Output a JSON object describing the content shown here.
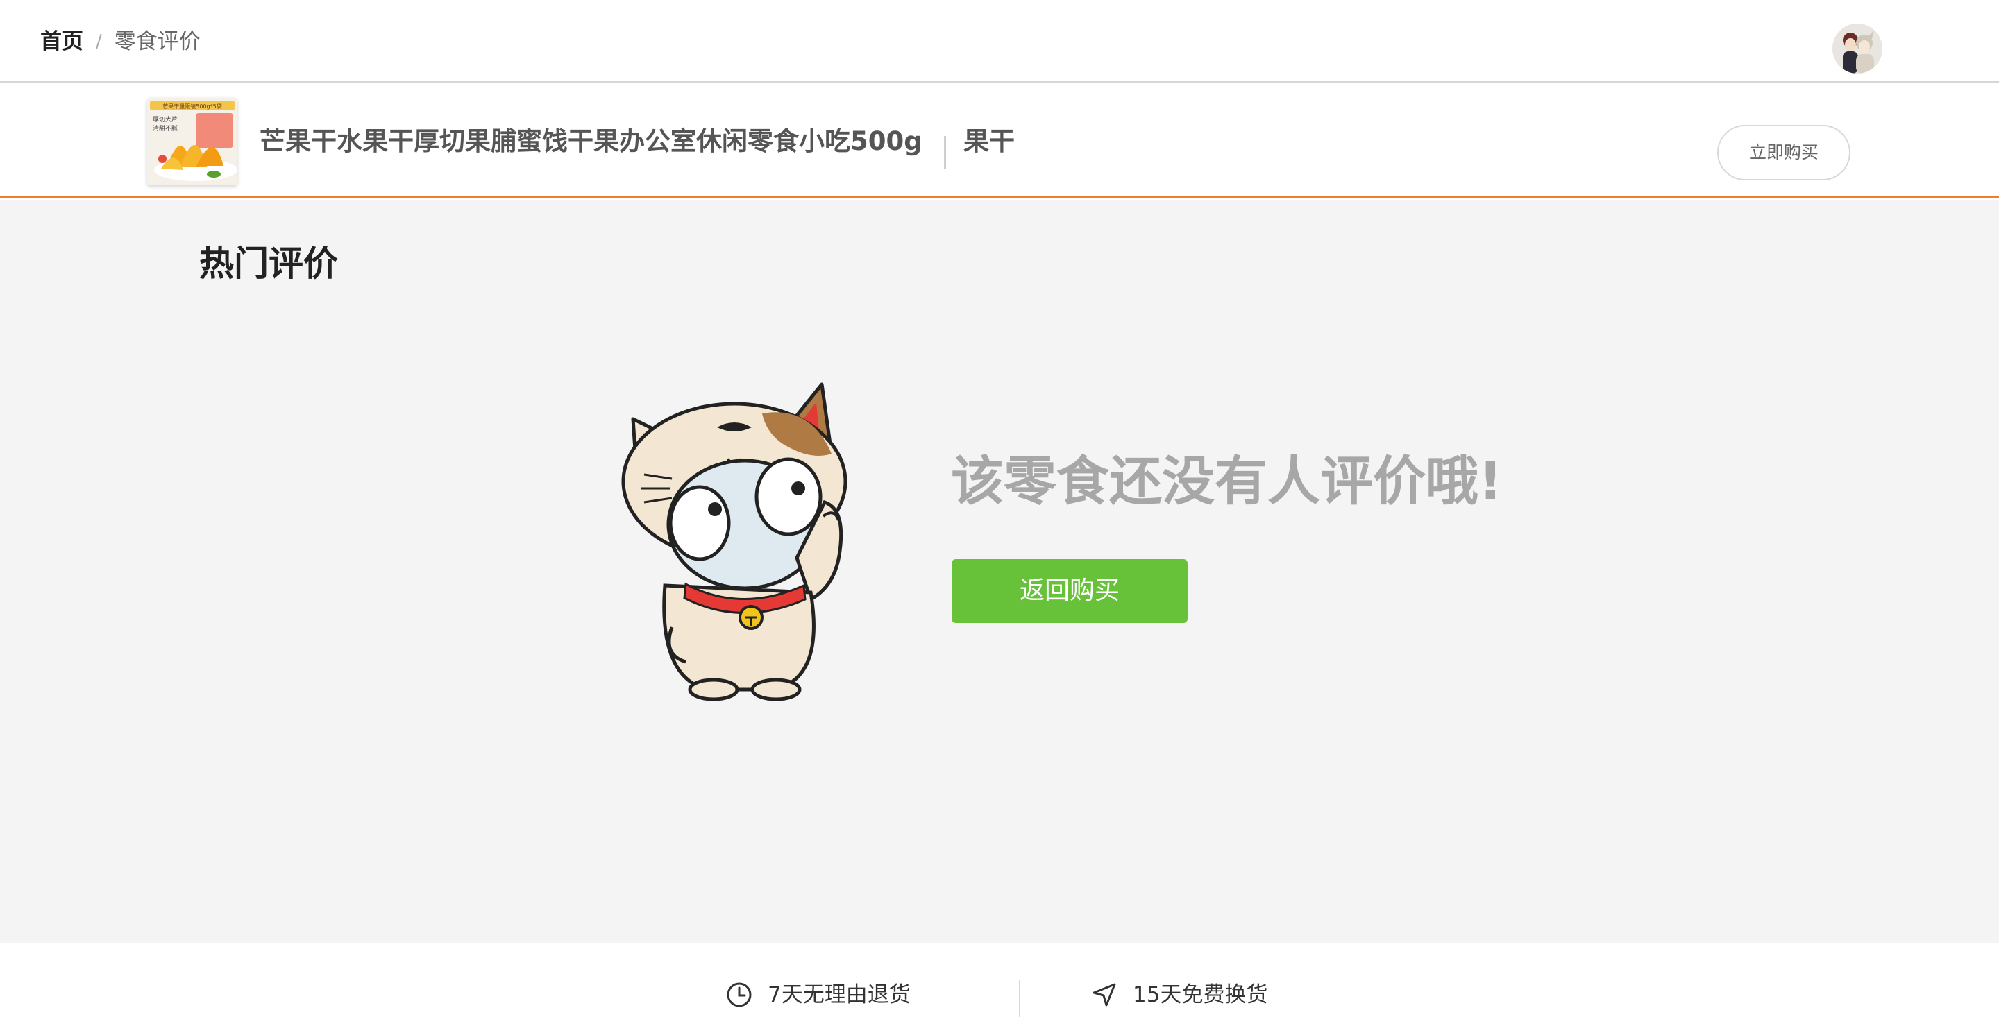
{
  "breadcrumb": {
    "home": "首页",
    "separator": "/",
    "current": "零食评价"
  },
  "product": {
    "name": "芒果干水果干厚切果脯蜜饯干果办公室休闲零食小吃500g",
    "category": "果干",
    "buy_now_label": "立即购买",
    "thumbnail_text": {
      "top_banner": "芒果干量贩装500g*5袋",
      "line1": "厚切大片",
      "line2": "清甜不腻"
    }
  },
  "reviews": {
    "section_title": "热门评价",
    "empty_message": "该零食还没有人评价哦!",
    "back_button_label": "返回购买"
  },
  "footer": {
    "guarantees": [
      {
        "icon": "clock-icon",
        "label": "7天无理由退货"
      },
      {
        "icon": "navigation-arrow-icon",
        "label": "15天免费换货"
      }
    ]
  },
  "colors": {
    "accent_orange": "#f07c2e",
    "button_green": "#67c23a",
    "page_background": "#f4f4f4",
    "empty_text": "#a7a7a7"
  }
}
